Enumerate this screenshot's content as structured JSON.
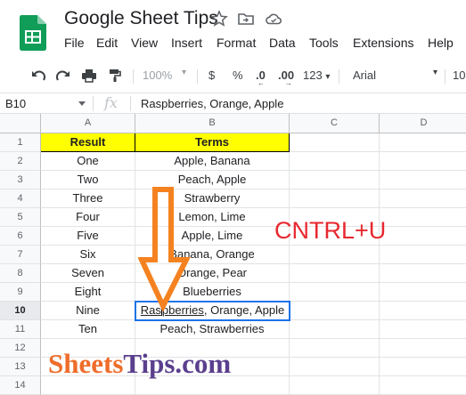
{
  "app": {
    "title": "Google Sheet Tips",
    "menu": [
      "File",
      "Edit",
      "View",
      "Insert",
      "Format",
      "Data",
      "Tools",
      "Extensions",
      "Help"
    ]
  },
  "toolbar": {
    "zoom": "100%",
    "currency": "$",
    "percent": "%",
    "decrease_decimal": ".0",
    "increase_decimal": ".00",
    "more_formats": "123",
    "font": "Arial",
    "font_size": "10"
  },
  "formula_bar": {
    "cell_ref": "B10",
    "fx": "fx",
    "content": "Raspberries, Orange, Apple"
  },
  "grid": {
    "columns": [
      "A",
      "B",
      "C",
      "D"
    ],
    "row_numbers": [
      "1",
      "2",
      "3",
      "4",
      "5",
      "6",
      "7",
      "8",
      "9",
      "10",
      "11",
      "12",
      "13",
      "14"
    ],
    "header_row": {
      "result": "Result",
      "terms": "Terms"
    },
    "rows": [
      {
        "result": "One",
        "terms": "Apple, Banana"
      },
      {
        "result": "Two",
        "terms": "Peach, Apple"
      },
      {
        "result": "Three",
        "terms": "Strawberry"
      },
      {
        "result": "Four",
        "terms": "Lemon, Lime"
      },
      {
        "result": "Five",
        "terms": "Apple, Lime"
      },
      {
        "result": "Six",
        "terms": "Banana, Orange"
      },
      {
        "result": "Seven",
        "terms": "Orange, Pear"
      },
      {
        "result": "Eight",
        "terms": "Blueberries"
      },
      {
        "result": "Nine",
        "terms_underlined_a": "Ras",
        "terms_underlined_b": "pberries",
        "terms_rest": ", Orange, Apple"
      },
      {
        "result": "Ten",
        "terms": "Peach, Strawberries"
      }
    ],
    "selected_cell": "B10"
  },
  "annotation": {
    "shortcut": "CNTRL+U"
  },
  "watermark": {
    "part1": "Sheets",
    "part2": "Tips.com"
  },
  "colors": {
    "header_fill": "#ffff00",
    "selection": "#1a73e8",
    "arrow": "#f58220",
    "shortcut_text": "#e8272f",
    "sheets_green": "#0f9d58"
  }
}
